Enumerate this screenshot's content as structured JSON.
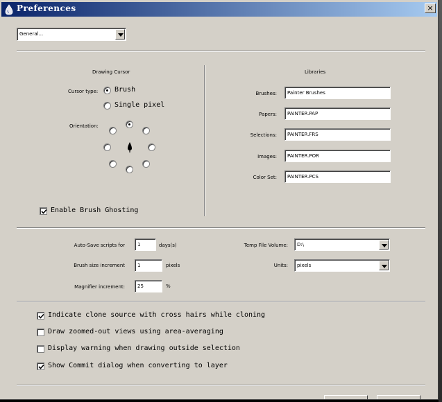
{
  "window": {
    "title": "Preferences",
    "close_label": "×"
  },
  "category_select": {
    "value": "General..."
  },
  "drawing_cursor": {
    "heading": "Drawing Cursor",
    "cursor_type_label": "Cursor type:",
    "options": [
      "Brush",
      "Single pixel"
    ],
    "selected": "Brush",
    "orientation_label": "Orientation:",
    "orientation_selected": "top"
  },
  "libraries": {
    "heading": "Libraries",
    "rows": [
      {
        "label": "Brushes:",
        "value": "Painter Brushes"
      },
      {
        "label": "Papers:",
        "value": "PAINTER.PAP"
      },
      {
        "label": "Selections:",
        "value": "PAINTER.FRS"
      },
      {
        "label": "Images:",
        "value": "PAINTER.POR"
      },
      {
        "label": "Color Set:",
        "value": "PAINTER.PCS"
      }
    ]
  },
  "enable_brush_ghosting": {
    "label": "Enable Brush Ghosting",
    "checked": true
  },
  "settings": {
    "autosave": {
      "label": "Auto-Save scripts for",
      "value": "1",
      "unit": "days(s)"
    },
    "brush_size": {
      "label": "Brush size increment",
      "value": "1",
      "unit": "pixels"
    },
    "magnifier": {
      "label": "Magnifier increment:",
      "value": "25",
      "unit": "%"
    },
    "temp_volume": {
      "label": "Temp File Volume:",
      "value": "D:\\"
    },
    "units": {
      "label": "Units:",
      "value": "pixels"
    }
  },
  "checkboxes": [
    {
      "label": "Indicate clone source with cross hairs while cloning",
      "checked": true
    },
    {
      "label": "Draw zoomed-out views using area-averaging",
      "checked": false
    },
    {
      "label": "Display warning when drawing outside selection",
      "checked": false
    },
    {
      "label": "Show Commit dialog when converting to layer",
      "checked": true
    }
  ]
}
